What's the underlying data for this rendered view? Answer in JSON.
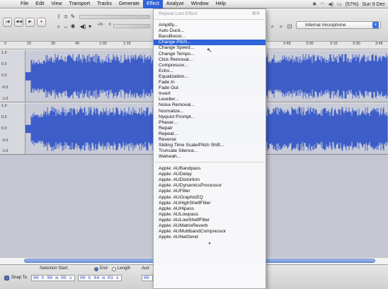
{
  "menubar": {
    "apple": "",
    "menus": [
      "File",
      "Edit",
      "View",
      "Transport",
      "Tracks",
      "Generate",
      "Effect",
      "Analyze",
      "Window",
      "Help"
    ],
    "active_menu": "Effect",
    "status": {
      "battery": "(57%)",
      "clock": "Sun 9 Dec"
    }
  },
  "toolbar": {
    "input_device": "Internal microphone",
    "meter_labels": [
      "-24",
      "0"
    ]
  },
  "ruler": {
    "ticks": [
      "0",
      "15",
      "30",
      "45",
      "1:00",
      "1:15",
      "2:45",
      "3:00",
      "3:15",
      "3:30",
      "3:45"
    ]
  },
  "tracks": [
    {
      "levels": [
        "1.0",
        "0.5",
        "0.0",
        "-0.5",
        "-1.0"
      ]
    },
    {
      "levels": [
        "1.0",
        "0.5",
        "0.0",
        "-0.5",
        "-1.0"
      ]
    }
  ],
  "effect_menu": {
    "repeat_last": "Repeat Last Effect",
    "repeat_shortcut": "⌘R",
    "group1": [
      "Amplify...",
      "Auto Duck...",
      "BassBoost..."
    ],
    "highlighted": "Change Pitch...",
    "group2": [
      "Change Speed...",
      "Change Tempo...",
      "Click Removal...",
      "Compressor...",
      "Echo...",
      "Equalization...",
      "Fade In",
      "Fade Out",
      "Invert",
      "Leveller...",
      "Noise Removal...",
      "Normalize...",
      "Nyquist Prompt...",
      "Phaser...",
      "Repair",
      "Repeat...",
      "Reverse",
      "Sliding Time Scale/Pitch Shift...",
      "Truncate Silence...",
      "Wahwah..."
    ],
    "plugins": [
      "Apple: AUBandpass",
      "Apple: AUDelay",
      "Apple: AUDistortion",
      "Apple: AUDynamicsProcessor",
      "Apple: AUFilter",
      "Apple: AUGraphicEQ",
      "Apple: AUHighShelfFilter",
      "Apple: AUHipass",
      "Apple: AULowpass",
      "Apple: AULowShelfFilter",
      "Apple: AUMatrixReverb",
      "Apple: AUMultibandCompressor",
      "Apple: AUNetSend"
    ],
    "more_indicator": "▼"
  },
  "selection_bar": {
    "selection_start_label": "Selection Start:",
    "end_label": "End",
    "length_label": "Length",
    "aud_label": "Aud",
    "snap_label": "Snap To",
    "start_time": "00 h 00 m 00 s",
    "end_time": "00 h 04 m 03 s",
    "extra_time": "00"
  },
  "colors": {
    "accent": "#2f63d8",
    "waveform": "#3d5ec9",
    "track_bg": "#c9cbd6"
  }
}
